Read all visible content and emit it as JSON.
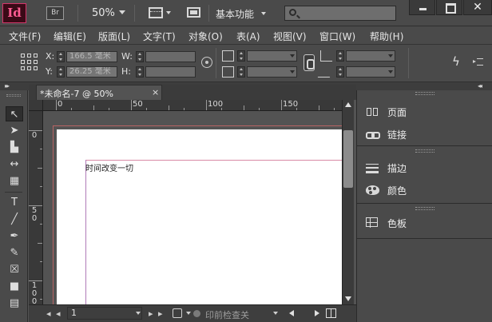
{
  "app": {
    "logo": "Id",
    "bridge": "Br",
    "zoom": "50%",
    "workspace": "基本功能",
    "search_placeholder": ""
  },
  "window_controls": {
    "close": "✕"
  },
  "menu": {
    "items": [
      "文件(F)",
      "编辑(E)",
      "版面(L)",
      "文字(T)",
      "对象(O)",
      "表(A)",
      "视图(V)",
      "窗口(W)",
      "帮助(H)"
    ]
  },
  "control_panel": {
    "x_label": "X:",
    "y_label": "Y:",
    "w_label": "W:",
    "h_label": "H:",
    "x_value": "166.5 毫米",
    "y_value": "26.25 毫米",
    "w_value": "",
    "h_value": ""
  },
  "document": {
    "tab_title": "*未命名-7 @ 50%",
    "tab_close": "×",
    "ruler_h": [
      "0",
      "50",
      "100",
      "150"
    ],
    "ruler_v": [
      "0",
      "5\n0",
      "1\n0\n0"
    ],
    "page_text": "时间改变一切"
  },
  "statusbar": {
    "page_number": "1",
    "preflight": "印前检查关"
  },
  "panels": {
    "groups": [
      {
        "items": [
          {
            "icon": "pages-icon",
            "label": "页面"
          },
          {
            "icon": "links-icon",
            "label": "链接"
          }
        ]
      },
      {
        "items": [
          {
            "icon": "stroke-icon",
            "label": "描边"
          },
          {
            "icon": "color-icon",
            "label": "颜色"
          }
        ]
      },
      {
        "items": [
          {
            "icon": "swatches-icon",
            "label": "色板"
          }
        ]
      }
    ]
  },
  "colors": {
    "indesign_brand": "#ff5c93",
    "ui_panel": "#4a4a4a",
    "margin_guide": "#d88aa6",
    "bleed_guide": "#b86464"
  }
}
